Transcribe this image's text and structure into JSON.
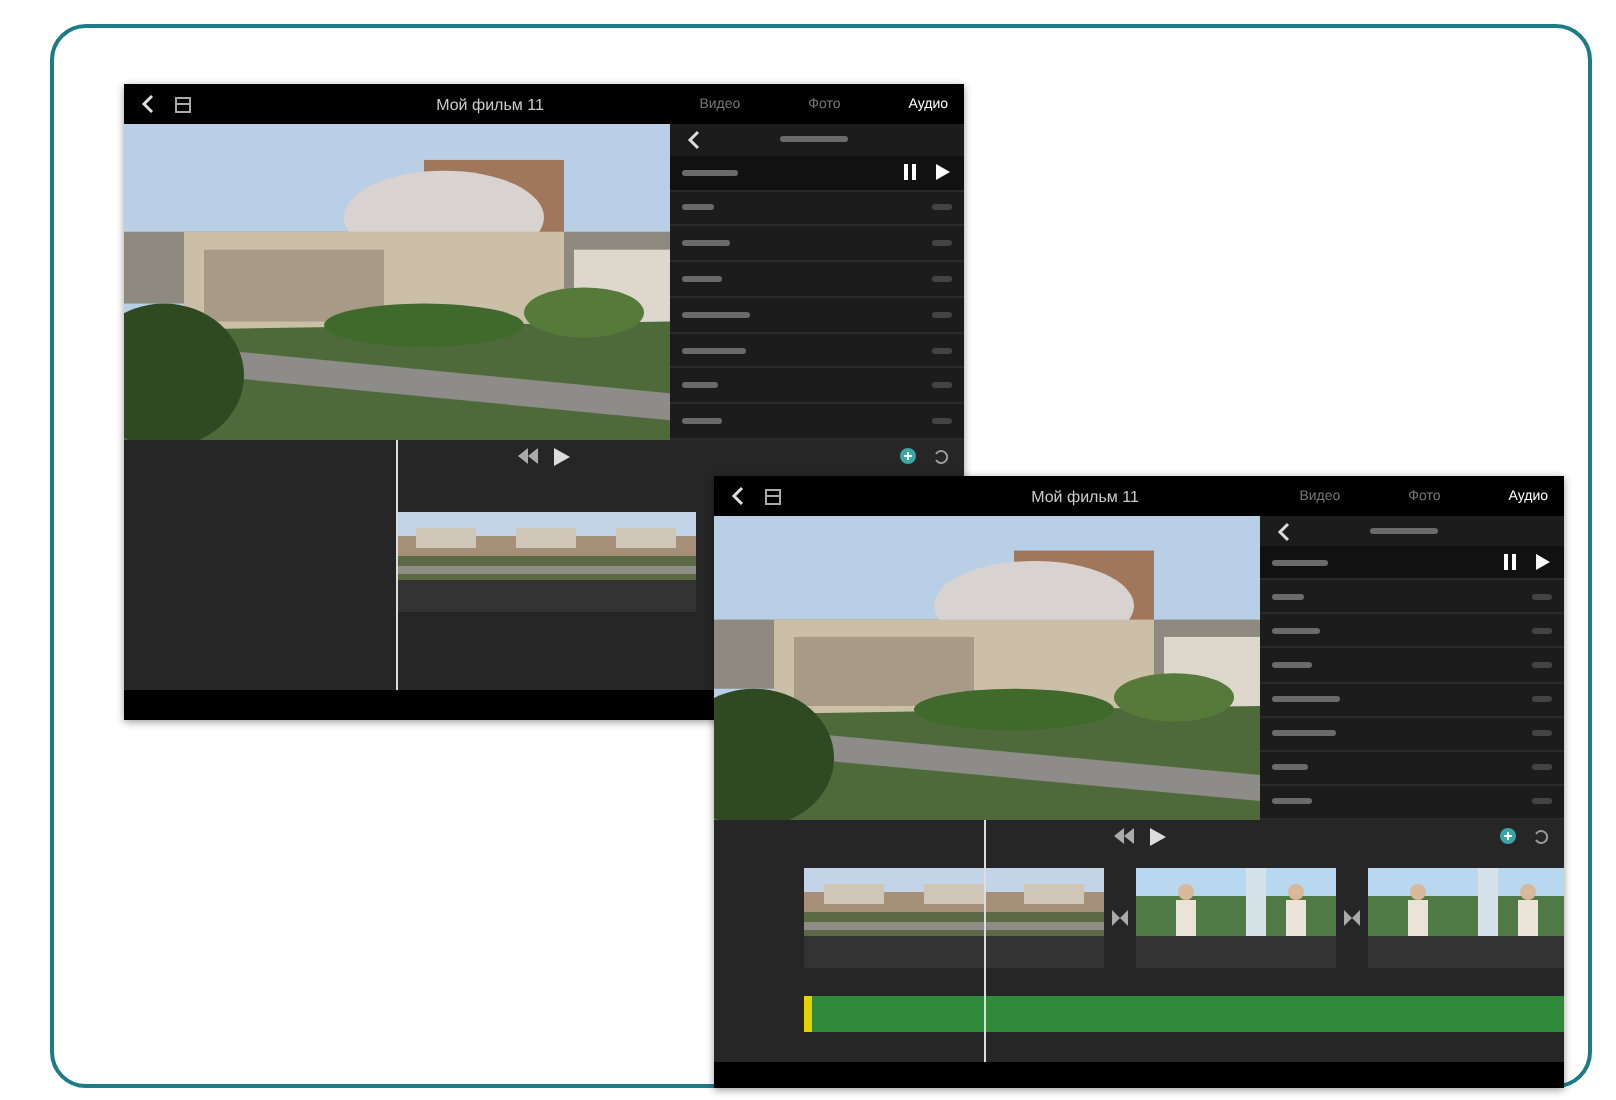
{
  "windows": [
    {
      "title": "Мой фильм 11",
      "tabs": [
        {
          "label": "Видео",
          "selected": false
        },
        {
          "label": "Фото",
          "selected": false
        },
        {
          "label": "Аудио",
          "selected": true
        }
      ],
      "clips": [
        {
          "kind": "building"
        }
      ],
      "audio_track": false
    },
    {
      "title": "Мой фильм 11",
      "tabs": [
        {
          "label": "Видео",
          "selected": false
        },
        {
          "label": "Фото",
          "selected": false
        },
        {
          "label": "Аудио",
          "selected": true
        }
      ],
      "clips": [
        {
          "kind": "building"
        },
        {
          "kind": "person"
        },
        {
          "kind": "person"
        }
      ],
      "audio_track": true
    }
  ]
}
